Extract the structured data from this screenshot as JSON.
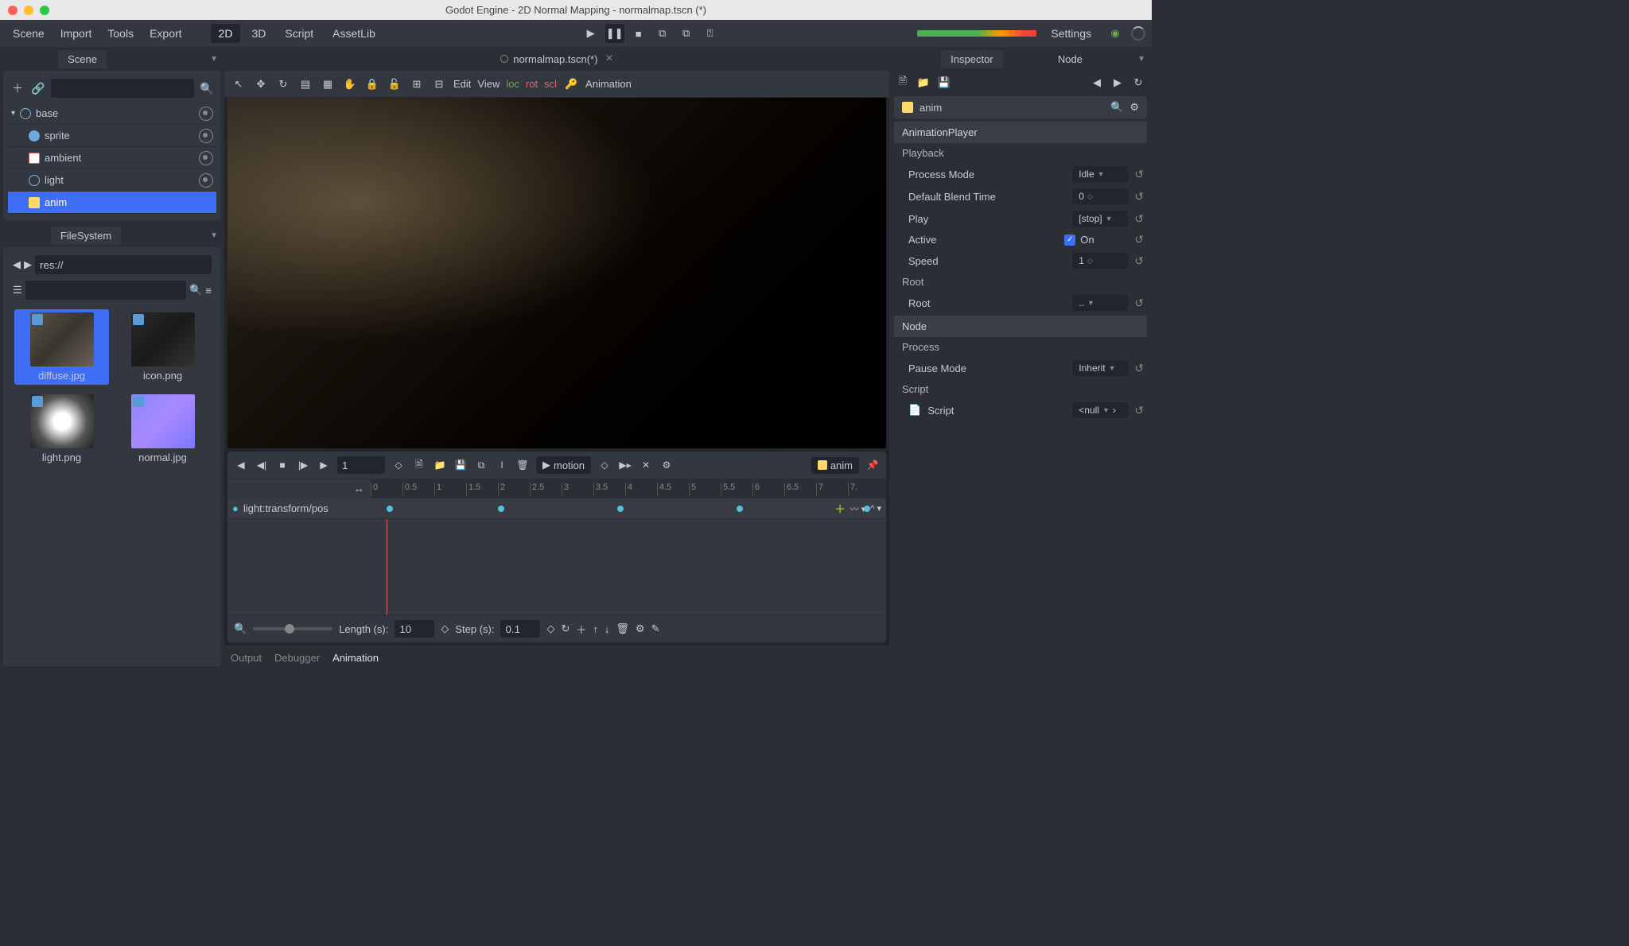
{
  "window": {
    "title": "Godot Engine - 2D Normal Mapping - normalmap.tscn (*)"
  },
  "menubar": {
    "items": [
      "Scene",
      "Import",
      "Tools",
      "Export"
    ],
    "modes": [
      {
        "label": "2D",
        "active": true
      },
      {
        "label": "3D",
        "active": false
      },
      {
        "label": "Script",
        "active": false
      },
      {
        "label": "AssetLib",
        "active": false
      }
    ],
    "settings": "Settings"
  },
  "doc_tab": {
    "label": "normalmap.tscn(*)"
  },
  "scene_dock": {
    "title": "Scene",
    "nodes": [
      {
        "name": "base",
        "icon": "node2d",
        "depth": 0,
        "selected": false,
        "vis": true
      },
      {
        "name": "sprite",
        "icon": "sprite",
        "depth": 1,
        "selected": false,
        "vis": true
      },
      {
        "name": "ambient",
        "icon": "canvas",
        "depth": 1,
        "selected": false,
        "vis": true
      },
      {
        "name": "light",
        "icon": "light",
        "depth": 1,
        "selected": false,
        "vis": true
      },
      {
        "name": "anim",
        "icon": "anim",
        "depth": 1,
        "selected": true,
        "vis": false
      }
    ]
  },
  "filesystem": {
    "title": "FileSystem",
    "path": "res://",
    "files": [
      {
        "name": "diffuse.jpg",
        "thumb": "diffuse",
        "selected": true
      },
      {
        "name": "icon.png",
        "thumb": "icon",
        "selected": false
      },
      {
        "name": "light.png",
        "thumb": "light",
        "selected": false
      },
      {
        "name": "normal.jpg",
        "thumb": "normal",
        "selected": false
      }
    ]
  },
  "viewport_toolbar": {
    "edit": "Edit",
    "view": "View",
    "loc": "loc",
    "rot": "rot",
    "scl": "scl",
    "animation": "Animation"
  },
  "anim": {
    "frame": "1",
    "clip": "motion",
    "name": "anim",
    "track": "light:transform/pos",
    "ticks": [
      "0",
      "0.5",
      "1",
      "1.5",
      "2",
      "2.5",
      "3",
      "3.5",
      "4",
      "4.5",
      "5",
      "5.5",
      "6",
      "6.5",
      "7",
      "7."
    ],
    "length_label": "Length (s):",
    "length": "10",
    "step_label": "Step (s):",
    "step": "0.1",
    "keyframes": [
      200,
      340,
      490,
      640,
      800
    ]
  },
  "bottom_tabs": [
    "Output",
    "Debugger",
    "Animation"
  ],
  "inspector": {
    "tabs": [
      "Inspector",
      "Node"
    ],
    "object": "anim",
    "class": "AnimationPlayer",
    "sections": [
      {
        "cat": "Playback",
        "props": [
          {
            "name": "Process Mode",
            "value": "Idle",
            "type": "enum"
          },
          {
            "name": "Default Blend Time",
            "value": "0",
            "type": "num"
          },
          {
            "name": "Play",
            "value": "[stop]",
            "type": "enum"
          },
          {
            "name": "Active",
            "value": "On",
            "type": "check"
          },
          {
            "name": "Speed",
            "value": "1",
            "type": "num"
          }
        ]
      },
      {
        "cat": "Root",
        "props": [
          {
            "name": "Root",
            "value": "..",
            "type": "enum"
          }
        ]
      }
    ],
    "node_section": "Node",
    "process_cat": "Process",
    "pause_mode": {
      "name": "Pause Mode",
      "value": "Inherit"
    },
    "script_cat": "Script",
    "script_prop": {
      "name": "Script",
      "value": "<null"
    }
  }
}
